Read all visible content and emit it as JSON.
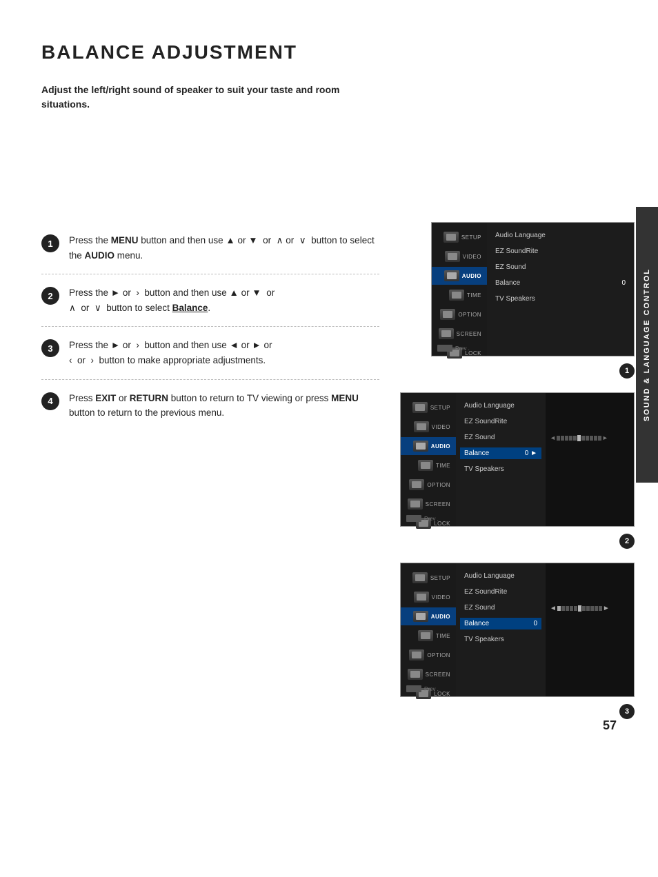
{
  "page": {
    "title": "BALANCE ADJUSTMENT",
    "subtitle": "Adjust the left/right sound of speaker to suit your taste and room situations.",
    "page_number": "57",
    "side_tab": "SOUND & LANGUAGE CONTROL"
  },
  "steps": [
    {
      "number": "1",
      "text_parts": [
        {
          "type": "plain",
          "text": "Press the "
        },
        {
          "type": "bold",
          "text": "MENU"
        },
        {
          "type": "plain",
          "text": " button and then use ▲ or ▼  or  ∧ or  ∨  button to select the "
        },
        {
          "type": "bold",
          "text": "AUDIO"
        },
        {
          "type": "plain",
          "text": " menu."
        }
      ]
    },
    {
      "number": "2",
      "text_parts": [
        {
          "type": "plain",
          "text": "Press the ► or  ›  button and then use ▲ or ▼  or  ∧ or  ∨  button to select "
        },
        {
          "type": "underline",
          "text": "Balance"
        },
        {
          "type": "plain",
          "text": "."
        }
      ]
    },
    {
      "number": "3",
      "text_parts": [
        {
          "type": "plain",
          "text": "Press the ► or  ›  button and then use ◄ or ► or  ‹  or  ›  button to make appropriate adjustments."
        }
      ]
    },
    {
      "number": "4",
      "text_parts": [
        {
          "type": "plain",
          "text": "Press "
        },
        {
          "type": "bold",
          "text": "EXIT"
        },
        {
          "type": "plain",
          "text": " or "
        },
        {
          "type": "bold",
          "text": "RETURN"
        },
        {
          "type": "plain",
          "text": " button to return to TV viewing or press "
        },
        {
          "type": "bold",
          "text": "MENU"
        },
        {
          "type": "plain",
          "text": " button to return to the previous menu."
        }
      ]
    }
  ],
  "screenshots": [
    {
      "badge": "1",
      "menu_items": [
        "SETUP",
        "VIDEO",
        "AUDIO",
        "TIME",
        "OPTION",
        "SCREEN",
        "LOCK"
      ],
      "audio_active": true,
      "options": [
        {
          "label": "Audio Language",
          "value": "",
          "highlighted": false
        },
        {
          "label": "EZ SoundRite",
          "value": "",
          "highlighted": false
        },
        {
          "label": "EZ Sound",
          "value": "",
          "highlighted": false
        },
        {
          "label": "Balance",
          "value": "0",
          "highlighted": false
        },
        {
          "label": "TV Speakers",
          "value": "",
          "highlighted": false
        }
      ],
      "show_balance_bar": false
    },
    {
      "badge": "2",
      "menu_items": [
        "SETUP",
        "VIDEO",
        "AUDIO",
        "TIME",
        "OPTION",
        "SCREEN",
        "LOCK"
      ],
      "audio_active": true,
      "options": [
        {
          "label": "Audio Language",
          "value": "",
          "highlighted": false
        },
        {
          "label": "EZ SoundRite",
          "value": "",
          "highlighted": false
        },
        {
          "label": "EZ Sound",
          "value": "",
          "highlighted": false
        },
        {
          "label": "Balance",
          "value": "0 ►",
          "highlighted": true
        },
        {
          "label": "TV Speakers",
          "value": "",
          "highlighted": false
        }
      ],
      "show_balance_bar": true
    },
    {
      "badge": "3",
      "menu_items": [
        "SETUP",
        "VIDEO",
        "AUDIO",
        "TIME",
        "OPTION",
        "SCREEN",
        "LOCK"
      ],
      "audio_active": true,
      "options": [
        {
          "label": "Audio Language",
          "value": "",
          "highlighted": false
        },
        {
          "label": "EZ SoundRite",
          "value": "",
          "highlighted": false
        },
        {
          "label": "EZ Sound",
          "value": "",
          "highlighted": false
        },
        {
          "label": "Balance",
          "value": "0",
          "highlighted": true
        },
        {
          "label": "TV Speakers",
          "value": "",
          "highlighted": false
        }
      ],
      "show_balance_bar": true,
      "balance_arrows": true
    }
  ],
  "menu_colors": {
    "active_menu_bg": "#004080",
    "menu_bg": "#1a1a1a",
    "option_panel_bg": "#1c1c1c"
  }
}
